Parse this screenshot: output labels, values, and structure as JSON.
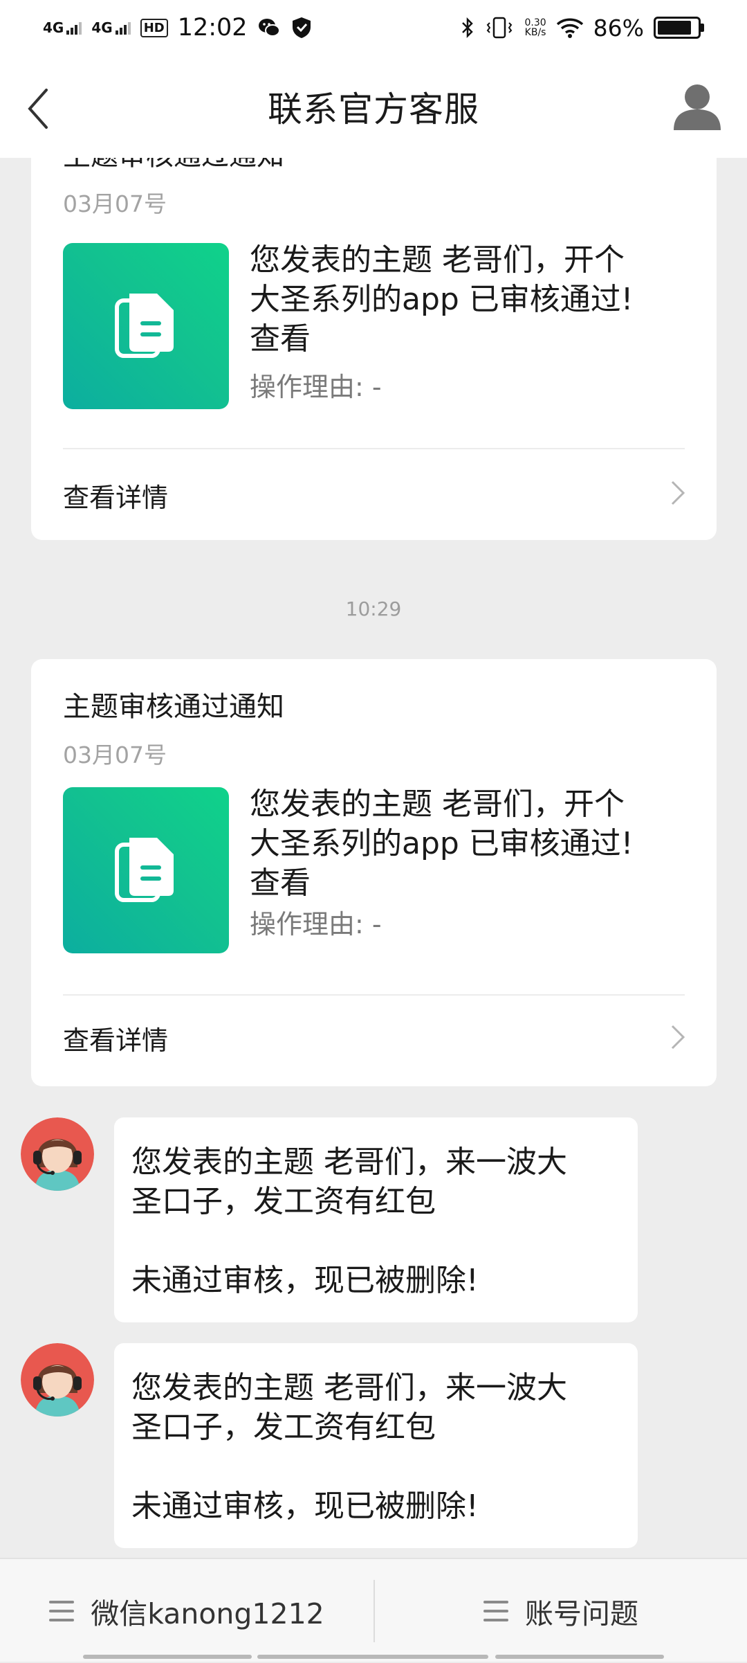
{
  "status_bar": {
    "net1": "4G",
    "net2": "4G",
    "hd": "HD",
    "time": "12:02",
    "speed_value": "0.30",
    "speed_unit": "KB/s",
    "battery": "86%",
    "battery_level": 0.86
  },
  "navbar": {
    "title": "联系官方客服",
    "back_icon": "chevron-left-icon",
    "user_icon": "user-icon"
  },
  "cards": [
    {
      "title": "主题审核通过通知",
      "date": "03月07号",
      "message_line1": "您发表的主题 老哥们，开个",
      "message_line2": "大圣系列的app 已审核通过!",
      "message_line3": "查看",
      "reason": "操作理由: -",
      "detail": "查看详情"
    },
    {
      "title": "主题审核通过通知",
      "date": "03月07号",
      "message_line1": "您发表的主题 老哥们，开个",
      "message_line2": "大圣系列的app 已审核通过!",
      "message_line3": "查看",
      "reason": "操作理由: -",
      "detail": "查看详情"
    }
  ],
  "timestamp": "10:29",
  "messages": [
    {
      "line1": "您发表的主题 老哥们，来一波大",
      "line2": "圣口子，发工资有红包",
      "line3": "未通过审核，现已被删除!"
    },
    {
      "line1": "您发表的主题 老哥们，来一波大",
      "line2": "圣口子，发工资有红包",
      "line3": "未通过审核，现已被删除!"
    }
  ],
  "bottom_tabs": [
    {
      "label": "微信kanong1212",
      "icon": "menu-icon"
    },
    {
      "label": "账号问题",
      "icon": "menu-icon"
    }
  ],
  "colors": {
    "background": "#ededed",
    "card": "#ffffff",
    "thumb_gradient_start": "#0cae9f",
    "thumb_gradient_end": "#10d28a",
    "secondary_text": "#a3a3a3"
  }
}
